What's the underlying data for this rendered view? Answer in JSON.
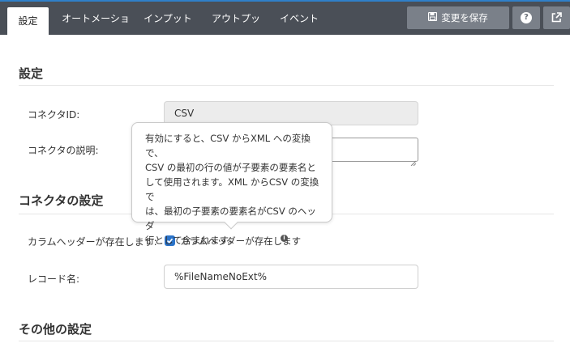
{
  "colors": {
    "topbar": "#4a4f57",
    "accent": "#2f80c9",
    "button": "#7a8089",
    "checkbox": "#2b73c9"
  },
  "tabs": [
    {
      "label": "設定",
      "active": true
    },
    {
      "label": "オートメーション",
      "active": false
    },
    {
      "label": "インプット",
      "active": false
    },
    {
      "label": "アウトプット",
      "active": false
    },
    {
      "label": "イベント",
      "active": false
    }
  ],
  "toolbar": {
    "save_label": "変更を保存",
    "save_icon": "floppy-disk-icon",
    "help_icon": "question-circle-icon",
    "help_glyph": "?",
    "external_icon": "external-link-icon"
  },
  "settings": {
    "title": "設定",
    "connector_id_label": "コネクタID:",
    "connector_id_value": "CSV",
    "description_label": "コネクタの説明:",
    "description_value": ""
  },
  "connector_settings": {
    "title": "コネクタの設定",
    "header_label": "カラムヘッダーが存在します:",
    "header_checkbox_label": "カラムヘッダーが存在します",
    "header_checked": true,
    "record_name_label": "レコード名:",
    "record_name_value": "%FileNameNoExt%"
  },
  "tooltip": {
    "lines": [
      "有効にすると、CSV からXML への変換で、",
      "CSV の最初の行の値が子要素の要素名と",
      "して使用されます。XML からCSV の変換で",
      "は、最初の子要素の要素名がCSV のヘッダ",
      "行として含まれます。"
    ]
  },
  "other_settings": {
    "title": "その他の設定"
  }
}
